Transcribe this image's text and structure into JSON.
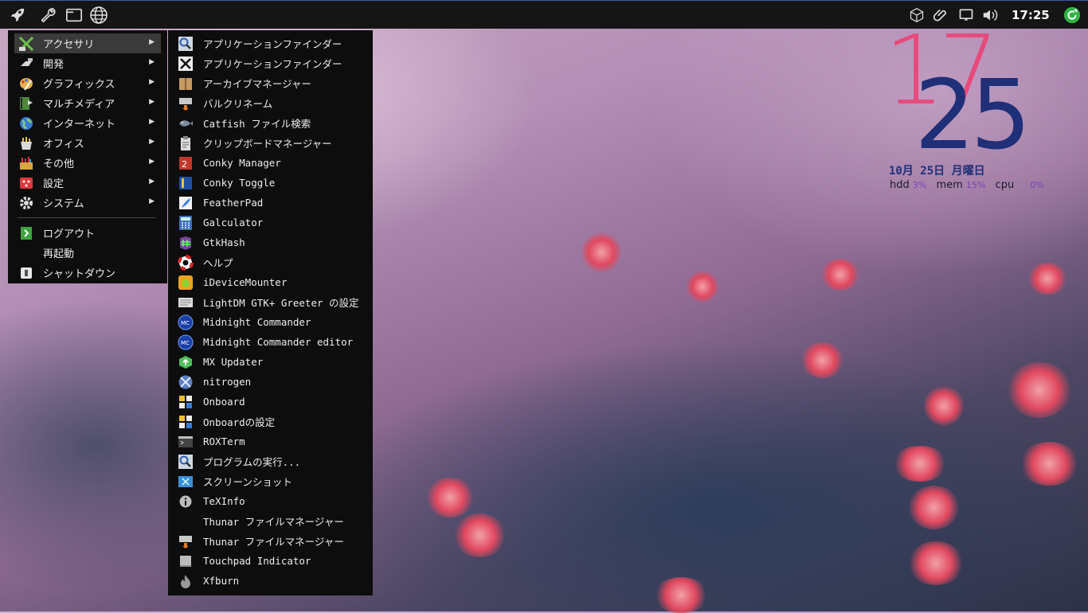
{
  "panel": {
    "icons": [
      "rocket-icon",
      "wrench-icon",
      "window-icon",
      "globe-icon"
    ],
    "tray_icons": [
      "package-icon",
      "paperclip-icon",
      "display-icon",
      "volume-icon",
      "update-icon"
    ],
    "clock": "17:25"
  },
  "main_menu": {
    "items": [
      {
        "label": "アクセサリ",
        "icon": "accessories-icon",
        "submenu": true
      },
      {
        "label": "開発",
        "icon": "development-icon",
        "submenu": true
      },
      {
        "label": "グラフィックス",
        "icon": "graphics-icon",
        "submenu": true
      },
      {
        "label": "マルチメディア",
        "icon": "multimedia-icon",
        "submenu": true
      },
      {
        "label": "インターネット",
        "icon": "internet-icon",
        "submenu": true
      },
      {
        "label": "オフィス",
        "icon": "office-icon",
        "submenu": true
      },
      {
        "label": "その他",
        "icon": "other-icon",
        "submenu": true
      },
      {
        "label": "設定",
        "icon": "settings-icon",
        "submenu": true
      },
      {
        "label": "システム",
        "icon": "system-icon",
        "submenu": true
      }
    ],
    "actions": [
      {
        "label": "ログアウト",
        "icon": "logout-icon"
      },
      {
        "label": "再起動",
        "icon": ""
      },
      {
        "label": "シャットダウン",
        "icon": "shutdown-icon"
      }
    ],
    "arrow": "▶"
  },
  "sub_menu": {
    "items": [
      {
        "label": "アプリケーションファインダー",
        "icon": "search-icon"
      },
      {
        "label": "アプリケーションファインダー",
        "icon": "x-icon"
      },
      {
        "label": "アーカイブマネージャー",
        "icon": "archive-icon"
      },
      {
        "label": "バルクリネーム",
        "icon": "rename-icon"
      },
      {
        "label": "Catfish ファイル検索",
        "icon": "catfish-icon"
      },
      {
        "label": "クリップボードマネージャー",
        "icon": "clipboard-icon"
      },
      {
        "label": "Conky Manager",
        "icon": "conky-manager-icon"
      },
      {
        "label": "Conky Toggle",
        "icon": "conky-toggle-icon"
      },
      {
        "label": "FeatherPad",
        "icon": "featherpad-icon"
      },
      {
        "label": "Galculator",
        "icon": "calculator-icon"
      },
      {
        "label": "GtkHash",
        "icon": "hash-icon"
      },
      {
        "label": "ヘルプ",
        "icon": "lifebuoy-icon"
      },
      {
        "label": "iDeviceMounter",
        "icon": "idevice-icon"
      },
      {
        "label": "LightDM GTK+ Greeter の設定",
        "icon": "lightdm-icon"
      },
      {
        "label": "Midnight Commander",
        "icon": "mc-icon"
      },
      {
        "label": "Midnight Commander editor",
        "icon": "mc-icon"
      },
      {
        "label": "MX Updater",
        "icon": "mx-updater-icon"
      },
      {
        "label": "nitrogen",
        "icon": "nitrogen-icon"
      },
      {
        "label": "Onboard",
        "icon": "onboard-icon"
      },
      {
        "label": "Onboardの設定",
        "icon": "onboard-icon"
      },
      {
        "label": "ROXTerm",
        "icon": "terminal-icon"
      },
      {
        "label": "プログラムの実行...",
        "icon": "search-icon"
      },
      {
        "label": "スクリーンショット",
        "icon": "screenshot-icon"
      },
      {
        "label": "TeXInfo",
        "icon": "info-icon"
      },
      {
        "label": "Thunar ファイルマネージャー",
        "icon": ""
      },
      {
        "label": "Thunar ファイルマネージャー",
        "icon": "rename-icon"
      },
      {
        "label": "Touchpad Indicator",
        "icon": "touchpad-icon"
      },
      {
        "label": "Xfburn",
        "icon": "flame-icon"
      }
    ]
  },
  "conky": {
    "hour": "17",
    "minute": "25",
    "date": "10月 25日 月曜日",
    "stats": [
      {
        "label": "hdd",
        "value": "3%"
      },
      {
        "label": "mem",
        "value": "15%"
      },
      {
        "label": "cpu",
        "value": "0%"
      }
    ]
  },
  "colors": {
    "conky_hour": "#e84a7c",
    "conky_minute": "#1f2f78",
    "panel_bg": "#151515",
    "menu_bg": "#0d0d0d",
    "selected": "#3a3a3a"
  }
}
